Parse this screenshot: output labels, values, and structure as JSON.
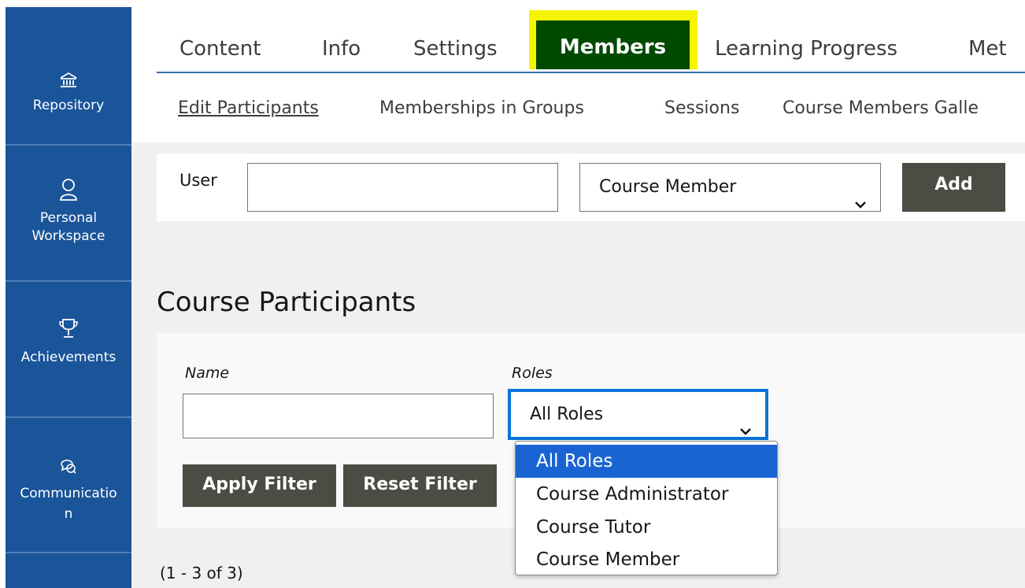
{
  "mainbar": {
    "items": [
      {
        "label": "Repository",
        "icon": "bank-icon"
      },
      {
        "label": "Personal Workspace",
        "label_line1": "Personal",
        "label_line2": "Workspace",
        "icon": "person-icon"
      },
      {
        "label": "Achievements",
        "icon": "trophy-icon"
      },
      {
        "label": "Communication",
        "label_line1": "Communicatio",
        "label_line2": "n",
        "icon": "chat-icon"
      }
    ]
  },
  "tabs": {
    "items": [
      "Content",
      "Info",
      "Settings",
      "Members",
      "Learning Progress",
      "Met"
    ],
    "active": "Members",
    "highlight_color": "#f5f500",
    "active_bg": "#004a00"
  },
  "subtabs": {
    "items": [
      "Edit Participants",
      "Memberships in Groups",
      "Sessions",
      "Course Members Galle"
    ]
  },
  "add_user": {
    "label": "User",
    "input_value": "",
    "role_selected": "Course Member",
    "button": "Add"
  },
  "section": {
    "title": "Course Participants"
  },
  "filter": {
    "name_label": "Name",
    "name_value": "",
    "roles_label": "Roles",
    "roles_selected": "All Roles",
    "apply_button": "Apply Filter",
    "reset_button": "Reset Filter"
  },
  "roles_dropdown": {
    "options": [
      "All Roles",
      "Course Administrator",
      "Course Tutor",
      "Course Member"
    ],
    "selected_index": 0
  },
  "pagination": {
    "range": "(1 - 3 of 3)"
  },
  "colors": {
    "mainbar_bg": "#1a559a",
    "button_bg": "#4c4c44",
    "focus_border": "#0b73d9",
    "dropdown_selected": "#1a63d2"
  }
}
